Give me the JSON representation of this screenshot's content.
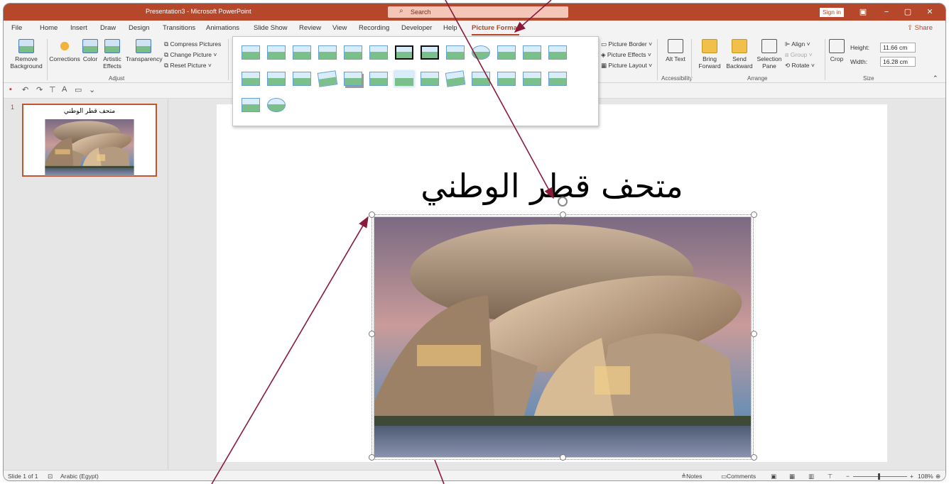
{
  "titlebar": {
    "title": "Presentation3  -  Microsoft PowerPoint",
    "search_placeholder": "Search",
    "signin": "Sign in",
    "window_icons": [
      "ribbon-display-icon",
      "minimize-icon",
      "maximize-icon",
      "close-icon"
    ]
  },
  "tabs": [
    "File",
    "Home",
    "Insert",
    "Draw",
    "Design",
    "Transitions",
    "Animations",
    "Slide Show",
    "Review",
    "View",
    "Recording",
    "Developer",
    "Help",
    "Picture Format"
  ],
  "active_tab": "Picture Format",
  "share_label": "Share",
  "ribbon": {
    "adjust": {
      "remove_bg": "Remove Background",
      "corrections": "Corrections",
      "color": "Color",
      "artistic": "Artistic Effects",
      "transparency": "Transparency",
      "compress": "Compress Pictures",
      "change": "Change Picture",
      "reset": "Reset Picture",
      "label": "Adjust"
    },
    "styles": {
      "border": "Picture Border",
      "effects": "Picture Effects",
      "layout": "Picture Layout"
    },
    "accessibility": {
      "alt_text": "Alt Text",
      "label": "Accessibility"
    },
    "arrange": {
      "bring_forward": "Bring Forward",
      "send_backward": "Send Backward",
      "selection_pane": "Selection Pane",
      "align": "Align",
      "group": "Group",
      "rotate": "Rotate",
      "label": "Arrange"
    },
    "size": {
      "crop": "Crop",
      "height_label": "Height:",
      "height_value": "11.66 cm",
      "width_label": "Width:",
      "width_value": "16.28 cm",
      "label": "Size"
    }
  },
  "gallery": {
    "styles": [
      "plain",
      "plain",
      "plain",
      "plain",
      "plain",
      "plain",
      "thick",
      "thick",
      "plain",
      "oval",
      "plain",
      "plain",
      "plain",
      "plain",
      "plain",
      "plain",
      "tilt",
      "shadow",
      "plain",
      "soft",
      "plain",
      "tilt",
      "plain",
      "plain",
      "plain",
      "plain",
      "plain",
      "oval"
    ]
  },
  "thumbnail": {
    "number": "1",
    "title": "متحف قطر الوطني"
  },
  "slide": {
    "title": "متحف قطر الوطني"
  },
  "statusbar": {
    "slide_info": "Slide 1 of 1",
    "language": "Arabic (Egypt)",
    "notes": "Notes",
    "comments": "Comments",
    "zoom": "108%"
  }
}
